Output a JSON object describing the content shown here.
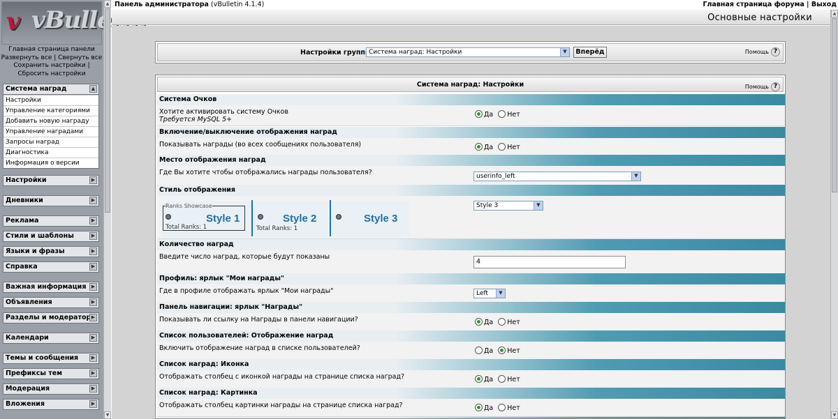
{
  "brand": {
    "logo_text": "vBulletin"
  },
  "left_links": [
    "Главная страница панели",
    "Развернуть все | Свернуть все",
    "Сохранить настройки |",
    "Сбросить настройки"
  ],
  "nav": {
    "open_group": {
      "title": "Система наград",
      "items": [
        "Настройки",
        "Управление категориями",
        "Добавить новую награду",
        "Управление наградами",
        "Запросы наград",
        "Диагностика",
        "Информация о версии"
      ]
    },
    "groups": [
      "Настройки",
      "Дневники",
      "Реклама",
      "Стили и шаблоны",
      "Языки и фразы",
      "Справка",
      "Важная информация",
      "Объявления",
      "Разделы и модераторы",
      "Календари",
      "Темы и сообщения",
      "Префиксы тем",
      "Модерация",
      "Вложения"
    ]
  },
  "top": {
    "title": "Панель администратора",
    "version": "(vBulletin 4.1.4)",
    "links": "Главная страница форума | Выход"
  },
  "header": {
    "title": "Основные настройки"
  },
  "group_select": {
    "label": "Настройки группы",
    "value": "Система наград: Настройки",
    "go": "Вперёд",
    "help": "Помощь"
  },
  "settings": {
    "title": "Система наград: Настройки",
    "help": "Помощь",
    "yes": "Да",
    "no": "Нет",
    "sections": [
      {
        "title": "Система Очков",
        "question": "Хотите активировать систему Очков",
        "note": "Требуется MySQL 5+",
        "answer": "yes"
      },
      {
        "title": "Включение/выключение отображения наград",
        "question": "Показывать награды (во всех сообщениях пользователя)",
        "answer": "yes"
      },
      {
        "title": "Место отображения наград",
        "question": "Где Вы хотите чтобы отображались награды пользователя?",
        "select": "userinfo_left"
      },
      {
        "title": "Стиль отображения",
        "select": "Style 3"
      },
      {
        "title": "Количество наград",
        "question": "Введите число наград, которые будут показаны",
        "input": "4"
      },
      {
        "title": "Профиль: ярлык \"Мои награды\"",
        "question": "Где в профиле отображать ярлык \"Мои награды\"",
        "select": "Left"
      },
      {
        "title": "Панель навигации: ярлык \"Награды\"",
        "question": "Показывать ли ссылку на Награды в панели навигации?",
        "answer": "yes"
      },
      {
        "title": "Список пользователей: Отображение наград",
        "question": "Включить отображение наград в списке пользователей?",
        "answer": "no"
      },
      {
        "title": "Список наград: Иконка",
        "question": "Отображать столбец с иконкой награды на странице списка наград?",
        "answer": "yes"
      },
      {
        "title": "Список наград: Картинка",
        "question": "Отображать столбец картинки награды на странице списка наград?",
        "answer": "yes"
      }
    ],
    "style_preview": {
      "showcase": "Ranks Showcase",
      "cards": [
        "Style 1",
        "Style 2",
        "Style 3"
      ],
      "total": "Total Ranks: 1"
    }
  }
}
